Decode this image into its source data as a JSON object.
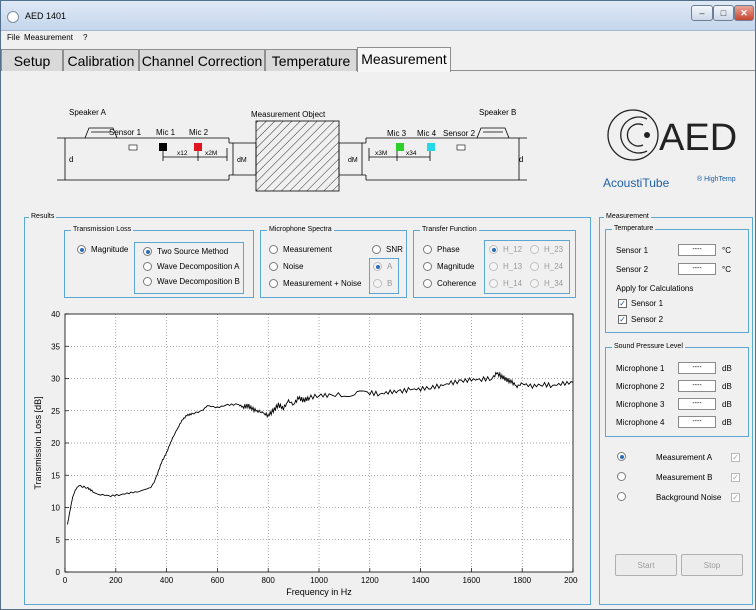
{
  "window": {
    "title": "AED 1401"
  },
  "menu": {
    "items": [
      "File",
      "Measurement",
      "?"
    ]
  },
  "tabs": [
    {
      "label": "Setup",
      "active": false
    },
    {
      "label": "Calibration",
      "active": false
    },
    {
      "label": "Channel Correction",
      "active": false
    },
    {
      "label": "Temperature",
      "active": false
    },
    {
      "label": "Measurement",
      "active": true
    }
  ],
  "schematic": {
    "speaker_a": "Speaker A",
    "speaker_b": "Speaker B",
    "sensor1": "Sensor 1",
    "sensor2": "Sensor 2",
    "mic1": "Mic 1",
    "mic2": "Mic 2",
    "mic3": "Mic 3",
    "mic4": "Mic 4",
    "object": "Measurement Object",
    "d": "d",
    "d_m": "dM",
    "x12": "x12",
    "x2m": "x2M",
    "x3m": "x3M",
    "x34": "x34",
    "mic_colors": {
      "mic1": "#000000",
      "mic2": "#e0141e",
      "mic3": "#2ad12a",
      "mic4": "#25d8e8"
    }
  },
  "logo": {
    "text": "AED",
    "subtitle": "AcoustiTube",
    "suffix": "® HighTemp",
    "color": "#1f5fa8"
  },
  "results": {
    "title": "Results",
    "transmission_loss": {
      "title": "Transmission Loss",
      "magnitude": "Magnitude",
      "options": [
        {
          "label": "Two Source Method",
          "selected": true
        },
        {
          "label": "Wave Decomposition A",
          "selected": false
        },
        {
          "label": "Wave Decomposition B",
          "selected": false
        }
      ]
    },
    "microphone_spectra": {
      "title": "Microphone Spectra",
      "options": [
        "Measurement",
        "Noise",
        "Measurement + Noise"
      ],
      "snr": "SNR",
      "ab": [
        "A",
        "B"
      ]
    },
    "transfer_function": {
      "title": "Transfer Function",
      "options": [
        "Phase",
        "Magnitude",
        "Coherence"
      ],
      "h": [
        "H_12",
        "H_23",
        "H_13",
        "H_24",
        "H_14",
        "H_34"
      ]
    }
  },
  "measurement_panel": {
    "title": "Measurement",
    "temperature": {
      "title": "Temperature",
      "rows": [
        {
          "label": "Sensor 1",
          "value": "----",
          "unit": "°C"
        },
        {
          "label": "Sensor 2",
          "value": "----",
          "unit": "°C"
        }
      ],
      "apply_label": "Apply for Calculations",
      "checks": [
        {
          "label": "Sensor 1",
          "checked": true
        },
        {
          "label": "Sensor 2",
          "checked": true
        }
      ]
    },
    "spl": {
      "title": "Sound Pressure Level",
      "rows": [
        {
          "label": "Microphone 1",
          "value": "----",
          "unit": "dB"
        },
        {
          "label": "Microphone 2",
          "value": "----",
          "unit": "dB"
        },
        {
          "label": "Microphone 3",
          "value": "----",
          "unit": "dB"
        },
        {
          "label": "Microphone 4",
          "value": "----",
          "unit": "dB"
        }
      ]
    },
    "modes": [
      {
        "label": "Measurement A",
        "selected": true,
        "checked": true
      },
      {
        "label": "Measurement B",
        "selected": false,
        "checked": true
      },
      {
        "label": "Background Noise",
        "selected": false,
        "checked": true
      }
    ],
    "start_label": "Start",
    "stop_label": "Stop"
  },
  "chart_data": {
    "type": "line",
    "title": "",
    "xlabel": "Frequency in Hz",
    "ylabel": "Transmission Loss [dB]",
    "xlim": [
      0,
      2000
    ],
    "ylim": [
      0,
      40
    ],
    "xticks": [
      0,
      200,
      400,
      600,
      800,
      1000,
      1200,
      1400,
      1600,
      1800,
      2000
    ],
    "yticks": [
      0,
      5,
      10,
      15,
      20,
      25,
      30,
      35,
      40
    ],
    "xtick_labels": [
      "0",
      "200",
      "400",
      "600",
      "800",
      "1000",
      "1200",
      "1400",
      "1600",
      "1800",
      "2000"
    ],
    "grid": "dotted",
    "x_visible_start_label": "",
    "series": [
      {
        "color": "#000000",
        "points": [
          [
            10,
            7.5
          ],
          [
            20,
            9.5
          ],
          [
            30,
            11.5
          ],
          [
            40,
            12.8
          ],
          [
            50,
            13.2
          ],
          [
            60,
            13.3
          ],
          [
            75,
            13.2
          ],
          [
            90,
            13.0
          ],
          [
            110,
            12.5
          ],
          [
            140,
            12.0
          ],
          [
            180,
            11.8
          ],
          [
            220,
            12.0
          ],
          [
            260,
            12.3
          ],
          [
            300,
            12.5
          ],
          [
            330,
            12.9
          ],
          [
            345,
            13.5
          ],
          [
            360,
            14.8
          ],
          [
            380,
            17.0
          ],
          [
            400,
            18.5
          ],
          [
            420,
            20.5
          ],
          [
            440,
            22.0
          ],
          [
            460,
            23.5
          ],
          [
            480,
            24.3
          ],
          [
            500,
            24.5
          ],
          [
            540,
            25.0
          ],
          [
            560,
            25.8
          ],
          [
            600,
            25.5
          ],
          [
            640,
            25.9
          ],
          [
            680,
            26.0
          ],
          [
            700,
            25.6
          ],
          [
            720,
            25.8
          ],
          [
            740,
            25.2
          ],
          [
            760,
            25.0
          ],
          [
            780,
            24.6
          ],
          [
            800,
            24.3
          ],
          [
            820,
            25.0
          ],
          [
            840,
            25.9
          ],
          [
            860,
            25.4
          ],
          [
            880,
            26.5
          ],
          [
            900,
            26.0
          ],
          [
            920,
            27.0
          ],
          [
            940,
            26.6
          ],
          [
            960,
            27.0
          ],
          [
            1000,
            27.4
          ],
          [
            1040,
            27.4
          ],
          [
            1100,
            27.5
          ],
          [
            1150,
            27.7
          ],
          [
            1200,
            27.8
          ],
          [
            1240,
            27.6
          ],
          [
            1280,
            27.9
          ],
          [
            1320,
            28.0
          ],
          [
            1360,
            28.3
          ],
          [
            1400,
            28.4
          ],
          [
            1440,
            28.6
          ],
          [
            1480,
            28.9
          ],
          [
            1520,
            29.3
          ],
          [
            1560,
            29.6
          ],
          [
            1600,
            29.8
          ],
          [
            1640,
            29.9
          ],
          [
            1680,
            30.0
          ],
          [
            1700,
            30.8
          ],
          [
            1720,
            30.3
          ],
          [
            1740,
            29.8
          ],
          [
            1760,
            29.4
          ],
          [
            1780,
            28.8
          ],
          [
            1800,
            29.2
          ],
          [
            1840,
            28.8
          ],
          [
            1880,
            29.1
          ],
          [
            1920,
            28.9
          ],
          [
            1960,
            29.2
          ],
          [
            2000,
            29.4
          ]
        ]
      }
    ]
  }
}
